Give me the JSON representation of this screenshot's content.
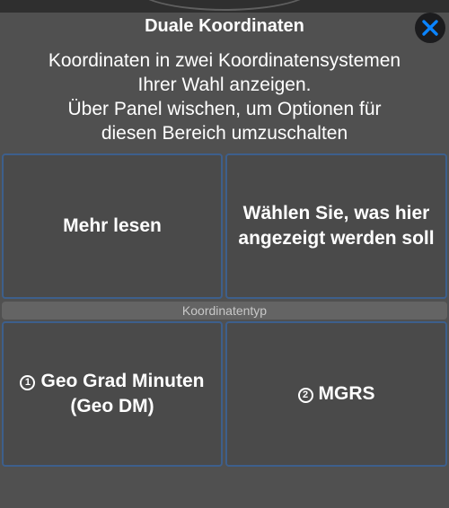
{
  "dialog": {
    "title": "Duale Koordinaten",
    "description_lines": [
      "Koordinaten in zwei Koordinatensystemen",
      "Ihrer Wahl anzeigen.",
      "Über Panel wischen, um Optionen für",
      "diesen Bereich umzuschalten"
    ],
    "close_icon": "close-x-icon",
    "accent_color": "#0a84ff"
  },
  "panels": {
    "more": {
      "label": "Mehr lesen"
    },
    "choose": {
      "lines": [
        "Wählen Sie, was hier",
        "angezeigt werden soll"
      ]
    }
  },
  "section": {
    "label": "Koordinatentyp"
  },
  "options": [
    {
      "number": "1",
      "lines": [
        "Geo Grad Minuten",
        "(Geo DM)"
      ]
    },
    {
      "number": "2",
      "lines": [
        "MGRS"
      ]
    }
  ]
}
